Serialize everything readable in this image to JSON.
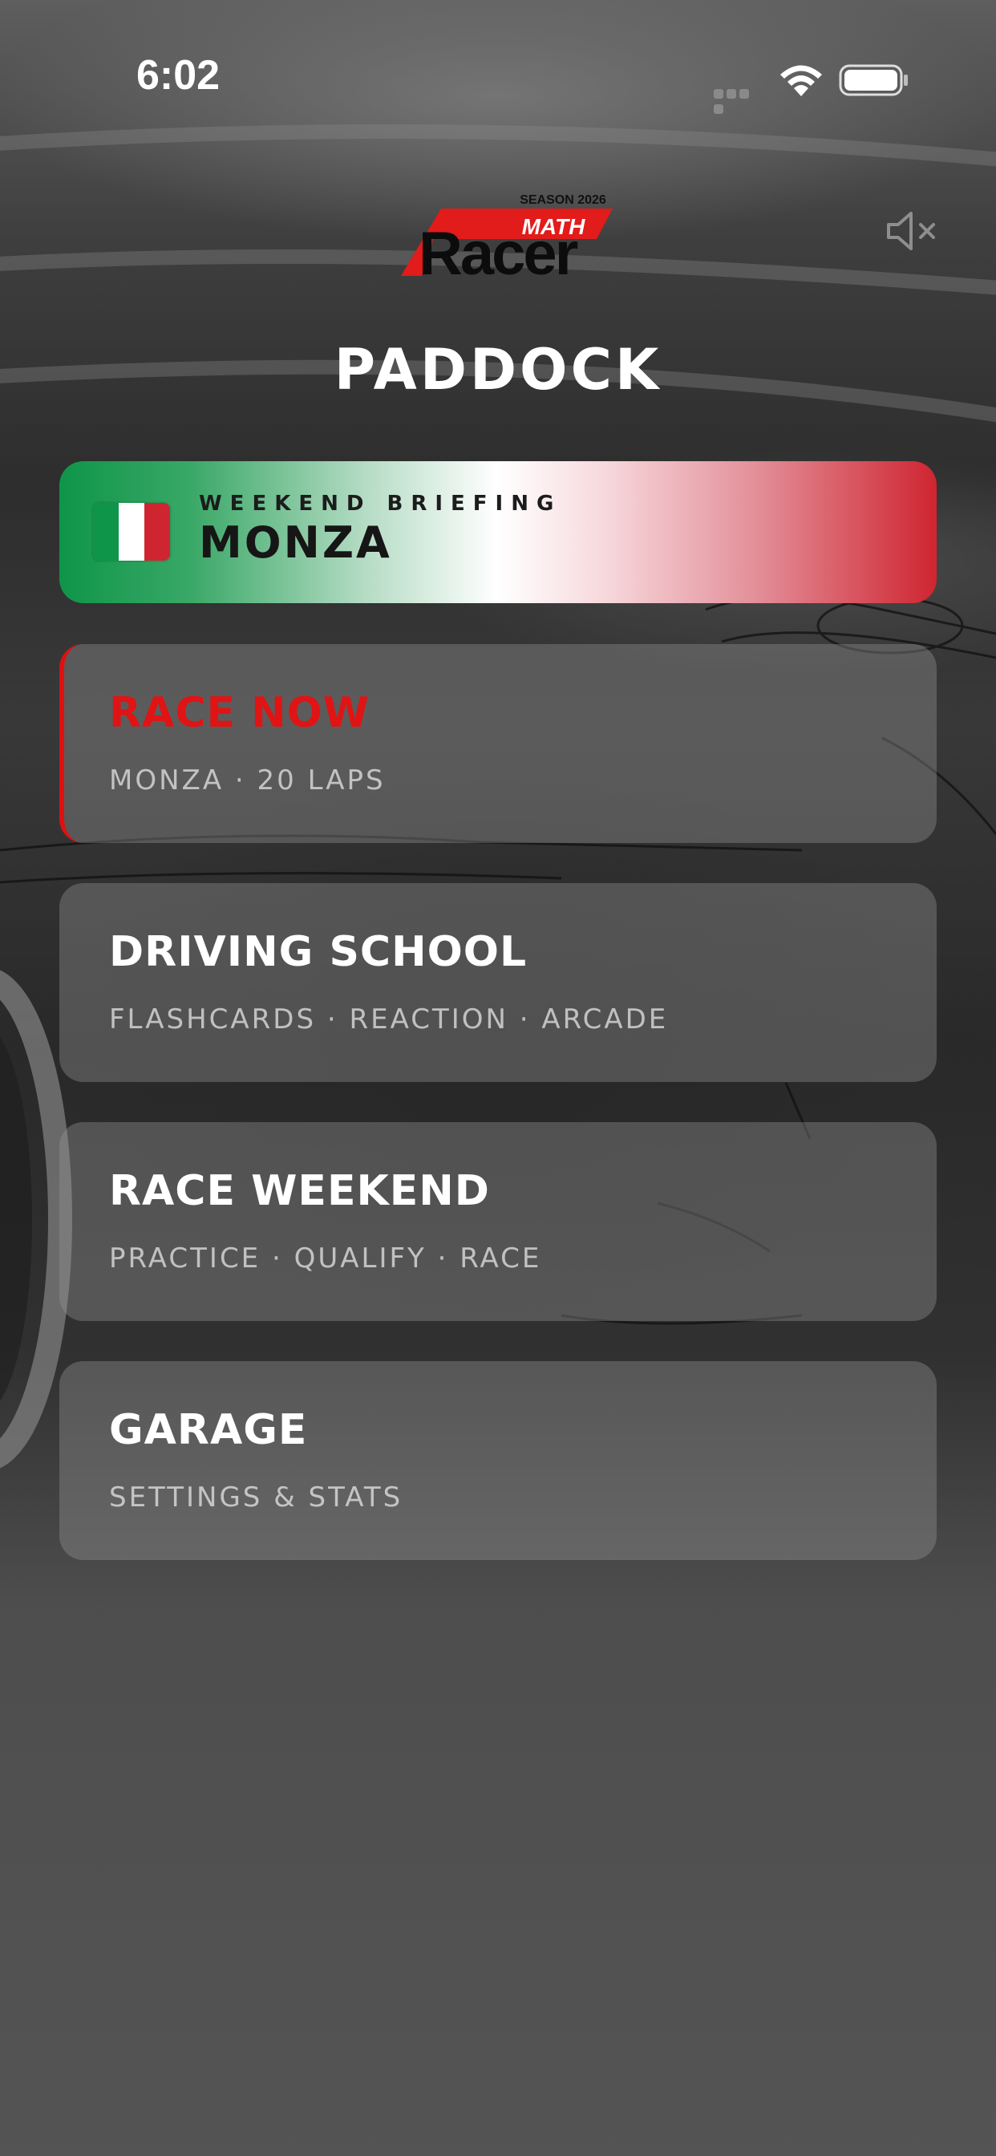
{
  "status_bar": {
    "time": "6:02",
    "icons": [
      "cellular-signal-icon",
      "wifi-icon",
      "battery-icon"
    ]
  },
  "header": {
    "logo_text": {
      "season": "SEASON 2026",
      "brand_top": "MATH",
      "brand_main": "Racer"
    },
    "mute_icon": "speaker-muted-icon",
    "title": "PADDOCK"
  },
  "briefing": {
    "kicker": "WEEKEND BRIEFING",
    "location": "MONZA",
    "flag": "italy-flag-icon",
    "colors": {
      "green": "#0e9549",
      "white": "#ffffff",
      "red": "#cf2530"
    }
  },
  "menu": {
    "items": [
      {
        "title": "RACE NOW",
        "subtitle": "MONZA · 20 LAPS"
      },
      {
        "title": "DRIVING SCHOOL",
        "subtitle": "FLASHCARDS · REACTION · ARCADE"
      },
      {
        "title": "RACE WEEKEND",
        "subtitle": "PRACTICE · QUALIFY · RACE"
      },
      {
        "title": "GARAGE",
        "subtitle": "SETTINGS & STATS"
      }
    ]
  },
  "colors": {
    "accent_red": "#e01414",
    "card_bg": "rgba(150,150,150,0.38)"
  }
}
